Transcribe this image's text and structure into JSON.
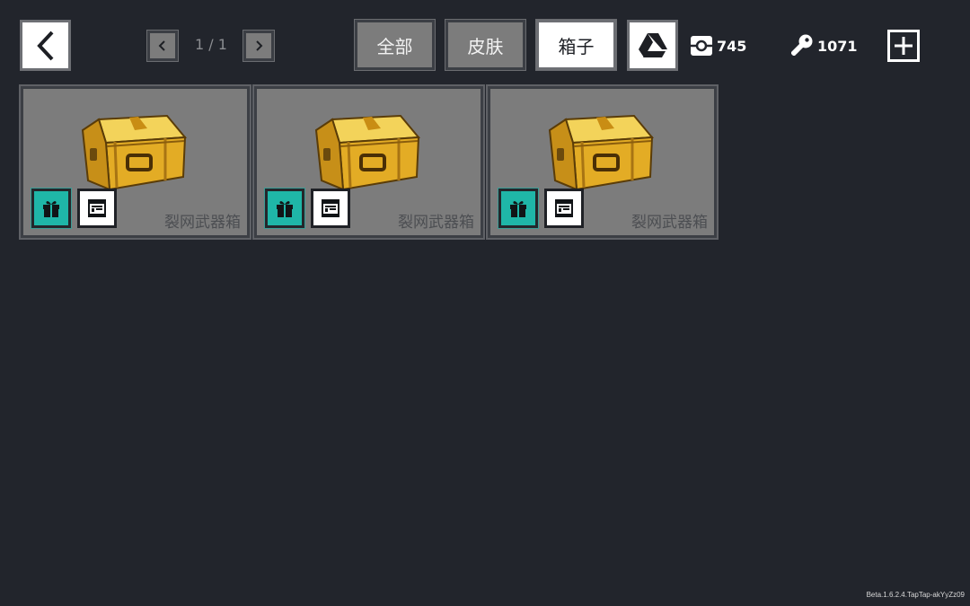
{
  "pager": {
    "text": "1 / 1"
  },
  "tabs": [
    {
      "label": "全部",
      "active": false
    },
    {
      "label": "皮肤",
      "active": false
    },
    {
      "label": "箱子",
      "active": true
    }
  ],
  "currencies": {
    "coins": "745",
    "keys": "1071"
  },
  "items": [
    {
      "name": "裂网武器箱"
    },
    {
      "name": "裂网武器箱"
    },
    {
      "name": "裂网武器箱"
    }
  ],
  "version": "Beta.1.6.2.4.TapTap-akYyZz09",
  "colors": {
    "background": "#22252c",
    "tile": "#7c7c7c",
    "accent_teal": "#1fb6a8",
    "box_gold": "#e8b830"
  }
}
